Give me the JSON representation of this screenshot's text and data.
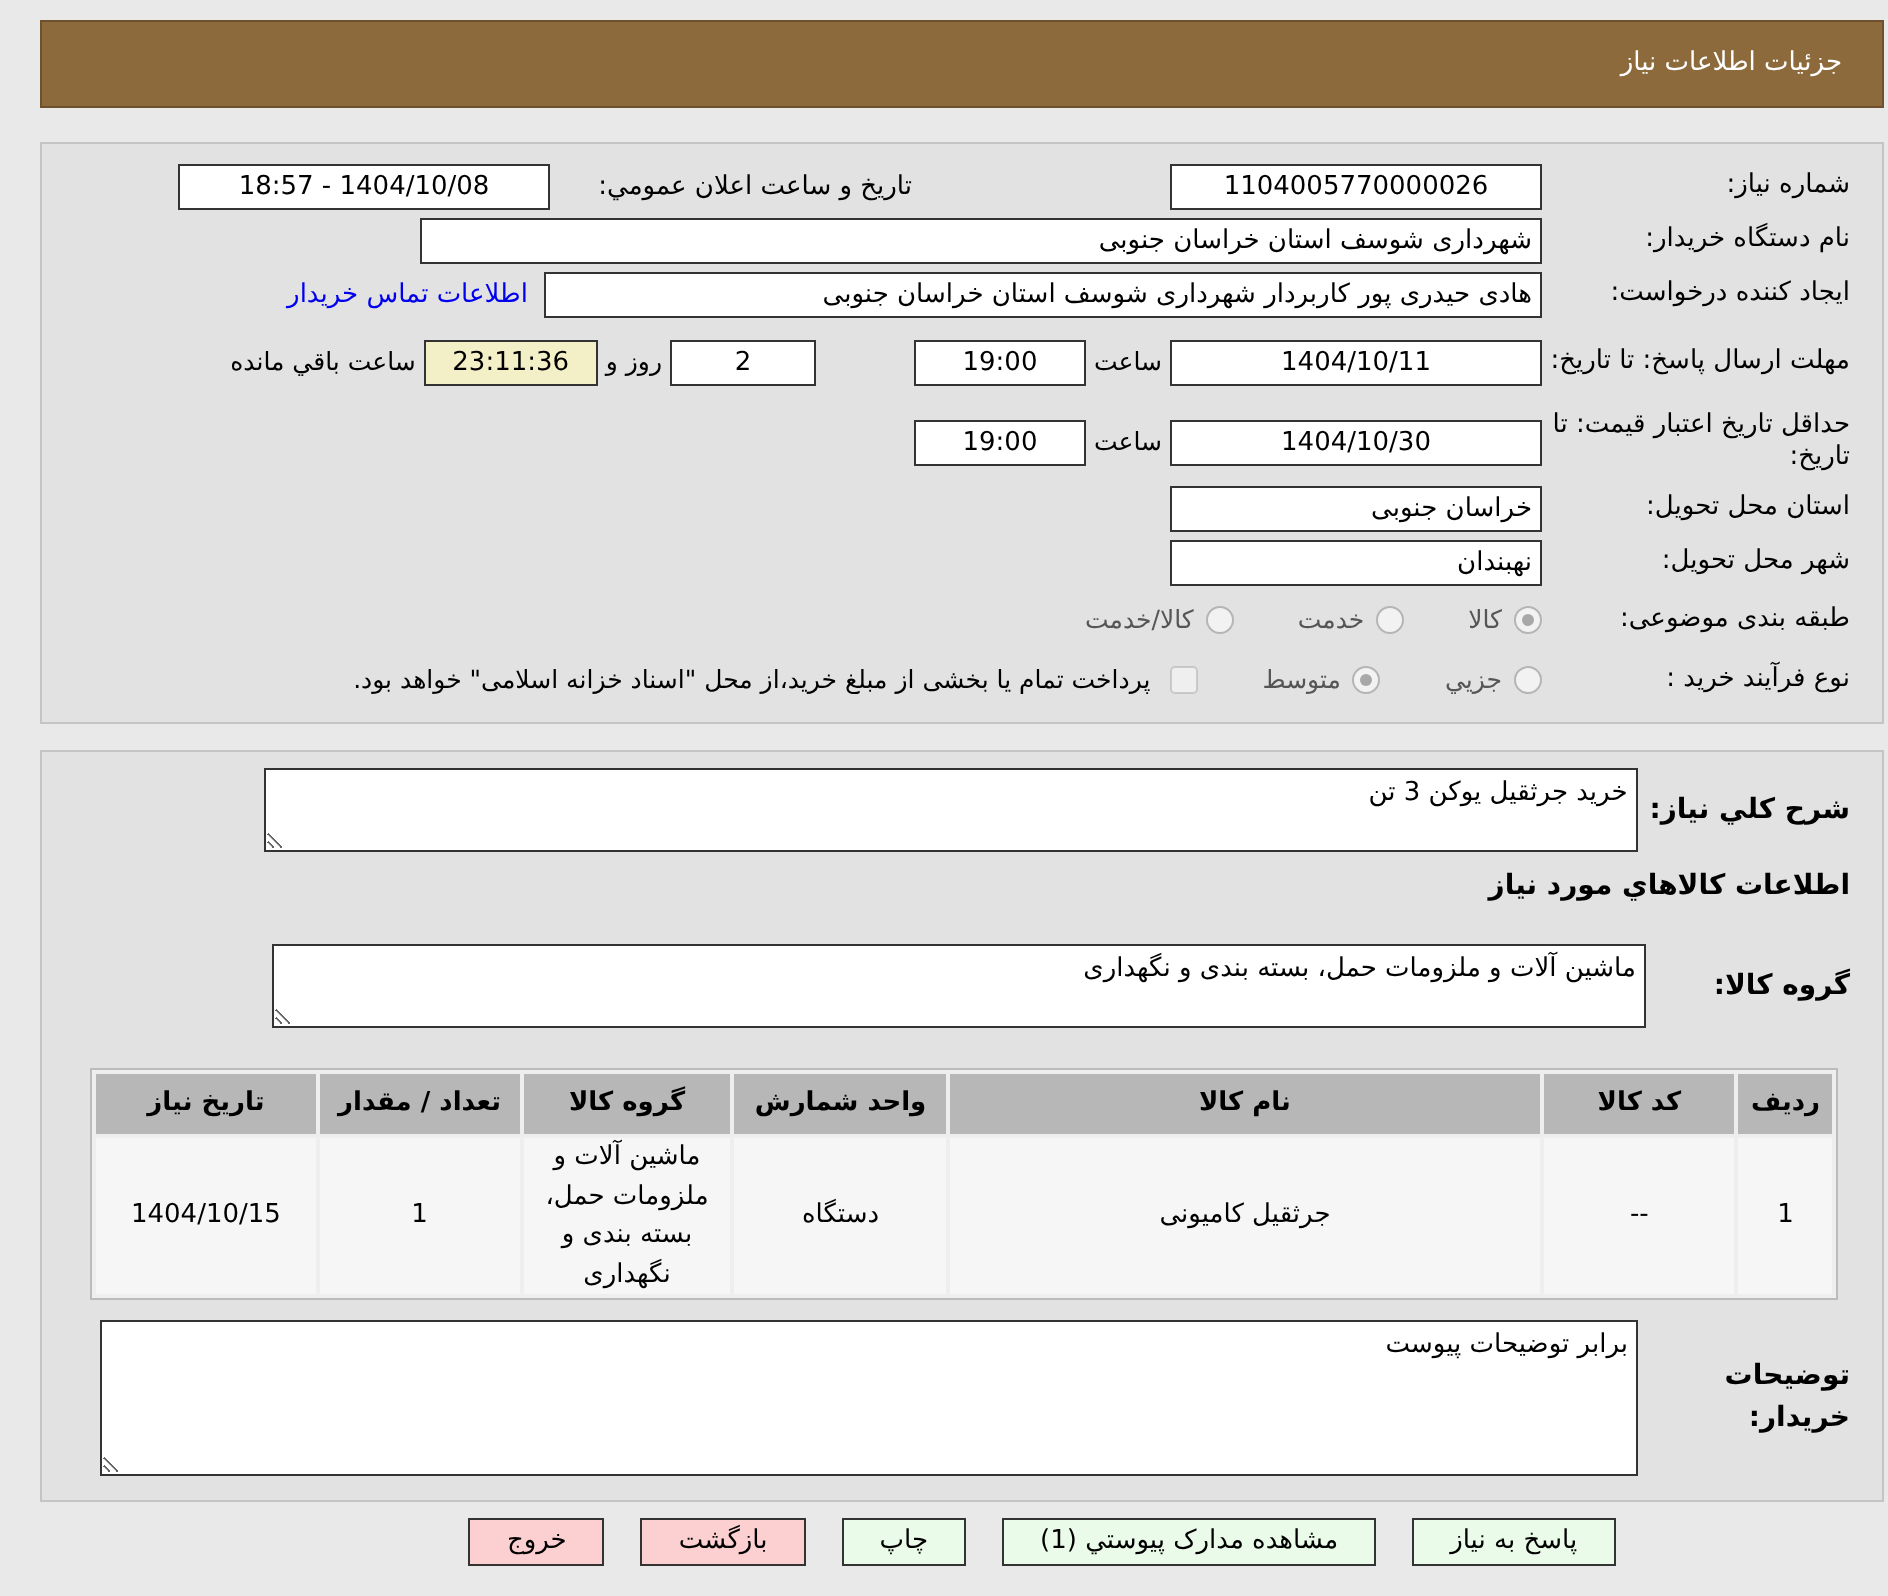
{
  "header": {
    "title": "جزئيات اطلاعات نياز"
  },
  "need_number": {
    "label": "شماره نياز:",
    "value": "1104005770000026"
  },
  "announce": {
    "label": "تاريخ و ساعت اعلان عمومي:",
    "value": "1404/10/08 - 18:57"
  },
  "buyer_org": {
    "label": "نام دستگاه خريدار:",
    "value": "شهرداری شوسف استان خراسان جنوبی"
  },
  "requester": {
    "label": "ايجاد كننده درخواست:",
    "value": "هادی حیدری پور کاربردار شهرداری شوسف استان خراسان جنوبی",
    "link": "اطلاعات تماس خريدار"
  },
  "reply_deadline": {
    "label": "مهلت ارسال پاسخ: تا تاريخ:",
    "date": "1404/10/11",
    "time_label": "ساعت",
    "time": "19:00",
    "days": "2",
    "days_label": "روز و",
    "remaining": "23:11:36",
    "remaining_label": "ساعت باقي مانده"
  },
  "price_validity": {
    "label": "حداقل تاريخ اعتبار قيمت: تا تاريخ:",
    "date": "1404/10/30",
    "time_label": "ساعت",
    "time": "19:00"
  },
  "province": {
    "label": "استان محل تحويل:",
    "value": "خراسان جنوبی"
  },
  "city": {
    "label": "شهر محل تحويل:",
    "value": "نهبندان"
  },
  "category": {
    "label": "طبقه بندی موضوعی:",
    "options": [
      {
        "label": "كالا",
        "selected": true,
        "disabled": true
      },
      {
        "label": "خدمت",
        "selected": false,
        "disabled": true
      },
      {
        "label": "كالا/خدمت",
        "selected": false,
        "disabled": true
      }
    ]
  },
  "process": {
    "label": "نوع فرآيند خريد :",
    "options": [
      {
        "label": "جزيي",
        "selected": false,
        "disabled": true
      },
      {
        "label": "متوسط",
        "selected": true,
        "disabled": true
      }
    ],
    "payment_note": {
      "checked": false,
      "disabled": true,
      "text": "پرداخت تمام يا بخشی از مبلغ خريد،از محل \"اسناد خزانه اسلامی\" خواهد بود."
    }
  },
  "description": {
    "label": "شرح كلي نياز:",
    "value": "خريد جرثقيل يوكن 3 تن"
  },
  "goods_heading": "اطلاعات كالاهاي مورد نياز",
  "goods_group": {
    "label": "گروه كالا:",
    "value": "ماشين آلات و ملزومات حمل، بسته بندی و نگهداری"
  },
  "table": {
    "columns": [
      "رديف",
      "كد كالا",
      "نام كالا",
      "واحد شمارش",
      "گروه كالا",
      "تعداد / مقدار",
      "تاريخ نياز"
    ],
    "rows": [
      [
        "1",
        "--",
        "جرثقیل کامیونی",
        "دستگاه",
        "ماشين آلات و ملزومات حمل، بسته بندی و نگهداری",
        "1",
        "1404/10/15"
      ]
    ]
  },
  "buyer_notes": {
    "label": "توضيحات خريدار:",
    "value": "برابر توضيحات پيوست"
  },
  "buttons": [
    {
      "label": "پاسخ به نياز",
      "kind": "normal"
    },
    {
      "label": "مشاهده مدارک پيوستي (1)",
      "kind": "normal"
    },
    {
      "label": "چاپ",
      "kind": "normal"
    },
    {
      "label": "بازگشت",
      "kind": "danger"
    },
    {
      "label": "خروج",
      "kind": "danger"
    }
  ]
}
